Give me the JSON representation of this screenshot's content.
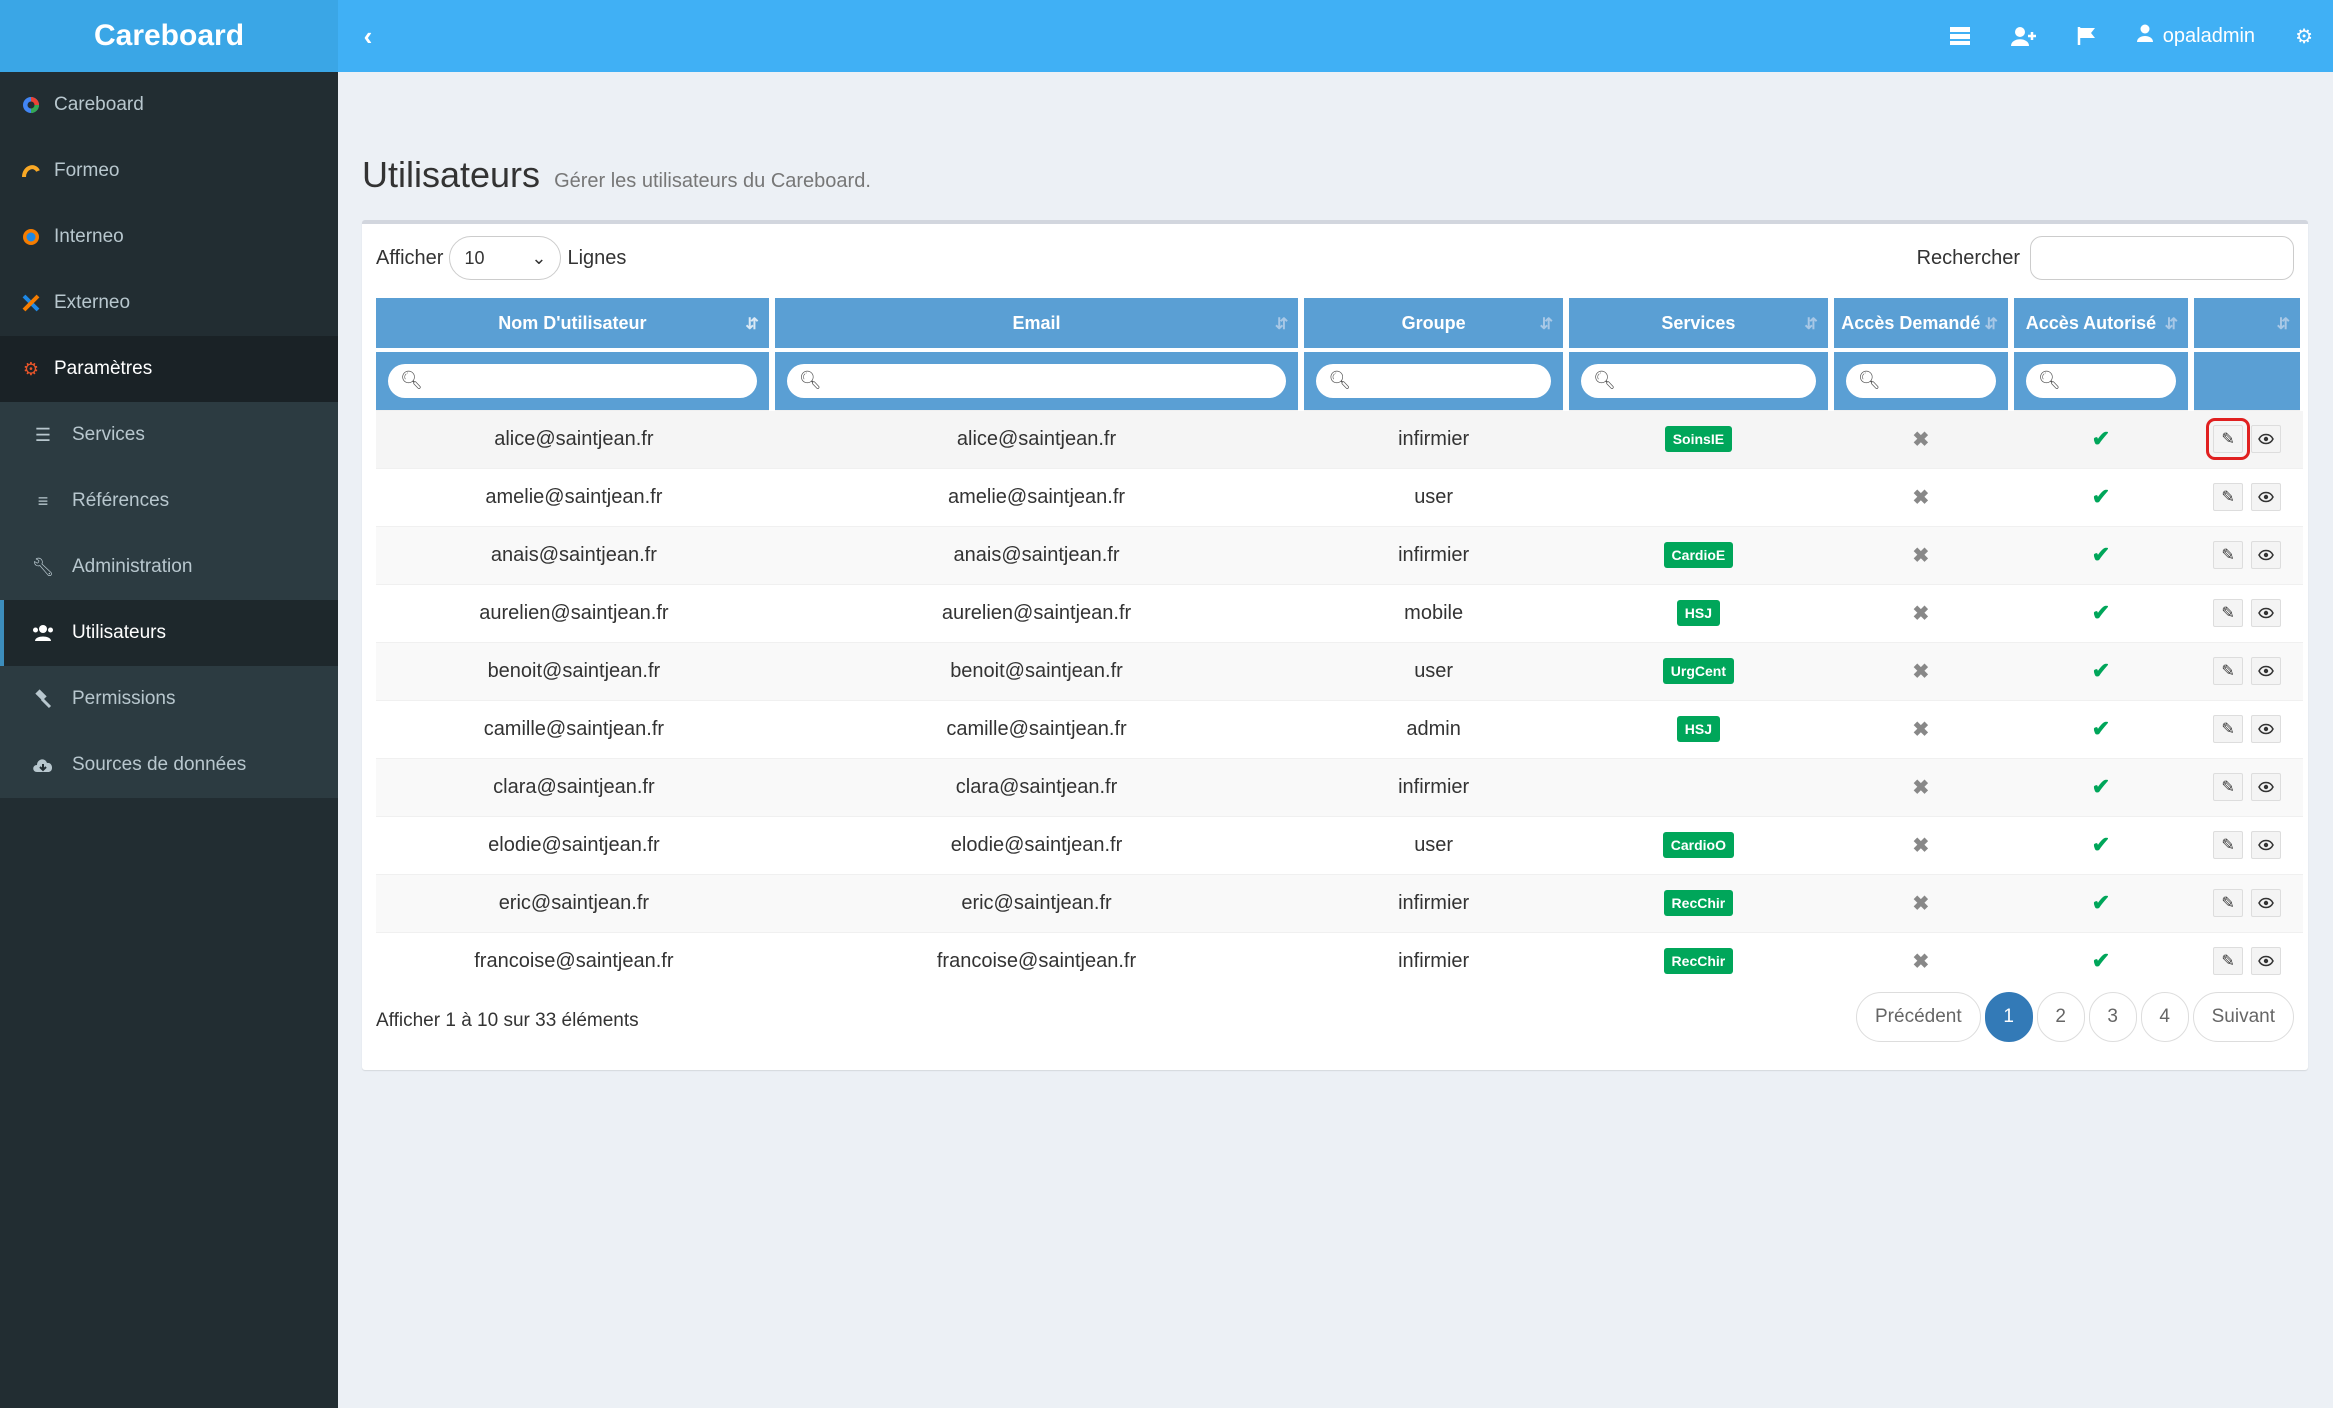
{
  "app": {
    "brand": "Careboard"
  },
  "sidebar": {
    "items": [
      {
        "label": "Careboard"
      },
      {
        "label": "Formeo"
      },
      {
        "label": "Interneo"
      },
      {
        "label": "Externeo"
      },
      {
        "label": "Paramètres"
      }
    ],
    "sub_items": [
      {
        "label": "Services"
      },
      {
        "label": "Références"
      },
      {
        "label": "Administration"
      },
      {
        "label": "Utilisateurs"
      },
      {
        "label": "Permissions"
      },
      {
        "label": "Sources de données"
      }
    ]
  },
  "topbar": {
    "username": "opaladmin"
  },
  "page": {
    "title": "Utilisateurs",
    "subtitle": "Gérer les utilisateurs du Careboard."
  },
  "toolbar": {
    "show_label": "Afficher",
    "rows_value": "10",
    "rows_label": "Lignes",
    "search_label": "Rechercher"
  },
  "table": {
    "columns": [
      "Nom D'utilisateur",
      "Email",
      "Groupe",
      "Services",
      "Accès Demandé",
      "Accès Autorisé",
      ""
    ],
    "rows": [
      {
        "username": "alice@saintjean.fr",
        "email": "alice@saintjean.fr",
        "group": "infirmier",
        "service": "SoinsIE"
      },
      {
        "username": "amelie@saintjean.fr",
        "email": "amelie@saintjean.fr",
        "group": "user",
        "service": ""
      },
      {
        "username": "anais@saintjean.fr",
        "email": "anais@saintjean.fr",
        "group": "infirmier",
        "service": "CardioE"
      },
      {
        "username": "aurelien@saintjean.fr",
        "email": "aurelien@saintjean.fr",
        "group": "mobile",
        "service": "HSJ"
      },
      {
        "username": "benoit@saintjean.fr",
        "email": "benoit@saintjean.fr",
        "group": "user",
        "service": "UrgCent"
      },
      {
        "username": "camille@saintjean.fr",
        "email": "camille@saintjean.fr",
        "group": "admin",
        "service": "HSJ"
      },
      {
        "username": "clara@saintjean.fr",
        "email": "clara@saintjean.fr",
        "group": "infirmier",
        "service": ""
      },
      {
        "username": "elodie@saintjean.fr",
        "email": "elodie@saintjean.fr",
        "group": "user",
        "service": "CardioO"
      },
      {
        "username": "eric@saintjean.fr",
        "email": "eric@saintjean.fr",
        "group": "infirmier",
        "service": "RecChir"
      },
      {
        "username": "francoise@saintjean.fr",
        "email": "francoise@saintjean.fr",
        "group": "infirmier",
        "service": "RecChir"
      }
    ]
  },
  "footer": {
    "info": "Afficher 1 à 10 sur 33 éléments",
    "prev": "Précédent",
    "next": "Suivant",
    "pages": [
      "1",
      "2",
      "3",
      "4"
    ],
    "current_page": "1"
  },
  "colors": {
    "topbar": "#40b0f5",
    "sidebar": "#222d32",
    "header": "#5a9fd4",
    "badge": "#00a65a",
    "active_page": "#337ab7"
  }
}
